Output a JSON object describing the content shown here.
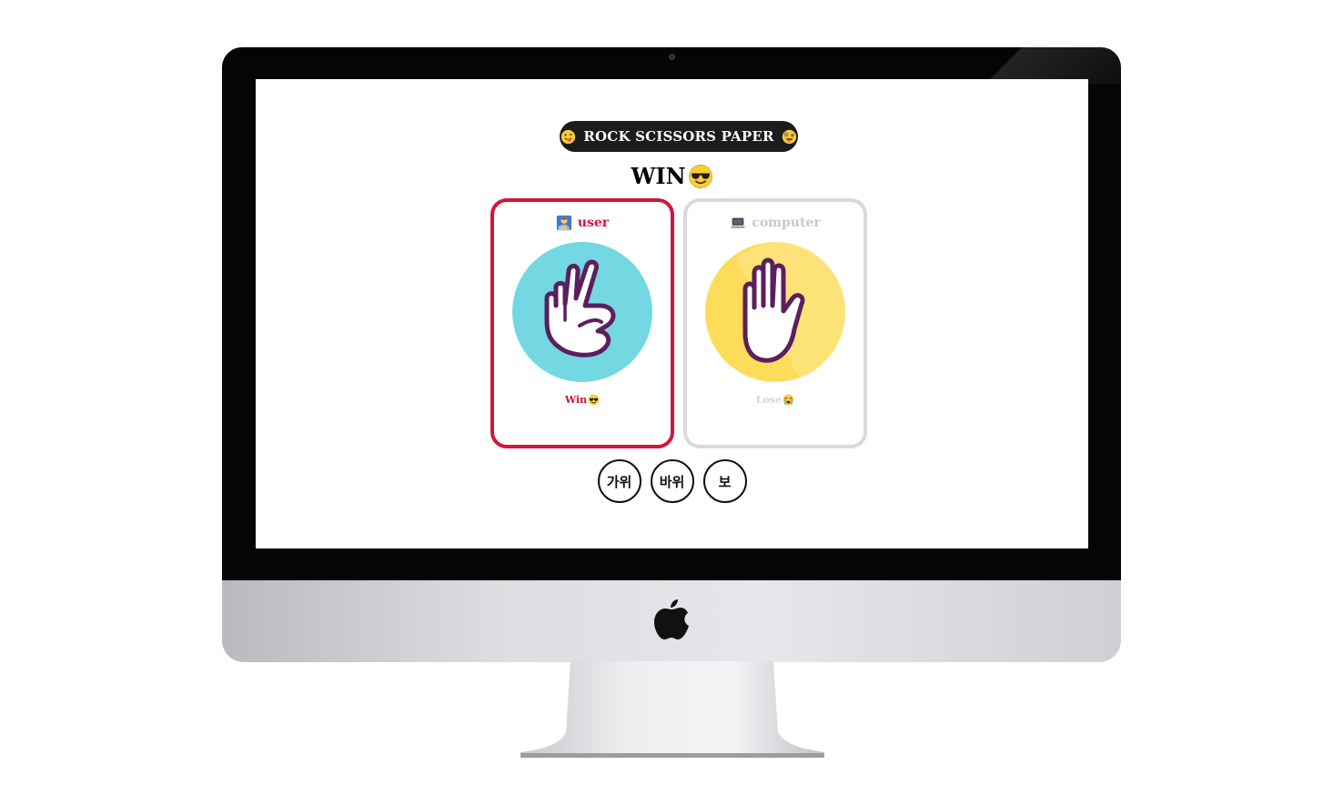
{
  "app": {
    "title": "ROCK SCISSORS PAPER",
    "title_left_icon": "tongue-wink-face-icon",
    "title_right_icon": "zany-face-icon"
  },
  "result": {
    "text": "WIN",
    "icon": "sunglasses-face-icon"
  },
  "cards": {
    "user": {
      "label": "user",
      "icon": "person-at-laptop-icon",
      "choice_icon": "scissors-hand-icon",
      "outcome": "Win",
      "outcome_icon": "sunglasses-face-icon",
      "accent": "#d0163a",
      "circle_color": "#73d8e1"
    },
    "computer": {
      "label": "computer",
      "icon": "laptop-icon",
      "choice_icon": "paper-hand-icon",
      "outcome": "Lose",
      "outcome_icon": "crying-face-icon",
      "accent": "#d9d9d9",
      "circle_color": "#fddc5a"
    }
  },
  "buttons": {
    "scissors": "가위",
    "rock": "바위",
    "paper": "보"
  }
}
